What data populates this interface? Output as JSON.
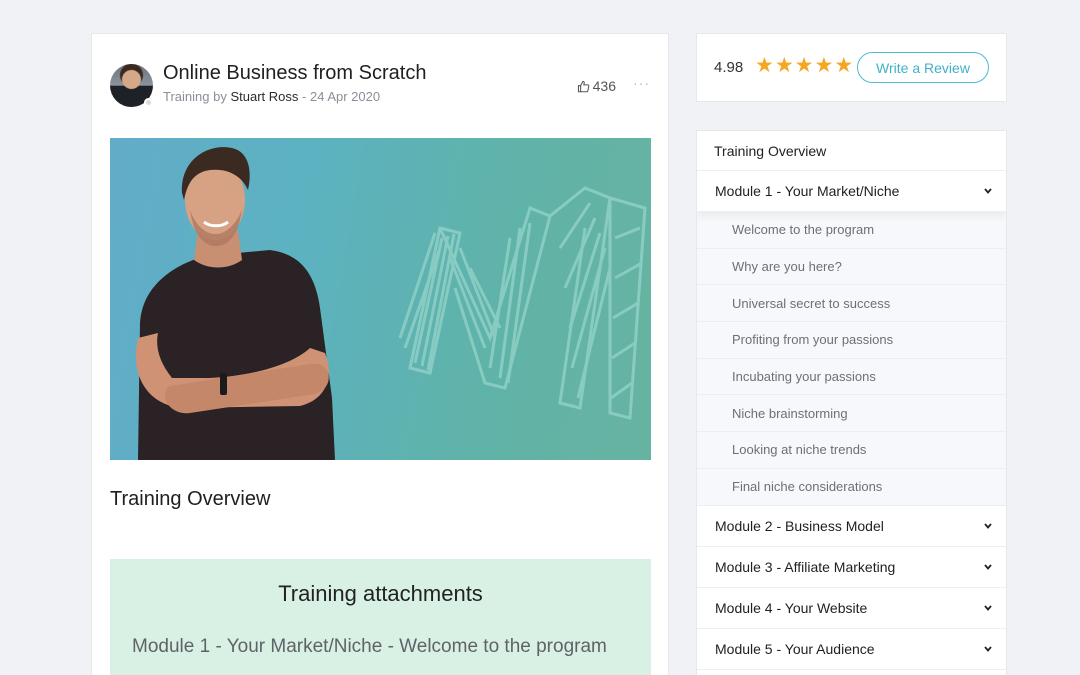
{
  "course": {
    "title": "Online Business from Scratch",
    "byline_prefix": "Training by",
    "author": "Stuart Ross",
    "date_sep": "-",
    "date": "24 Apr 2020",
    "likes": "436",
    "more": "···"
  },
  "main": {
    "overview_title": "Training Overview",
    "attachments_title": "Training attachments",
    "attachment_item": "Module 1 - Your Market/Niche - Welcome to the program"
  },
  "rating": {
    "score": "4.98",
    "stars": 5,
    "write_review": "Write a Review"
  },
  "sidebar": {
    "overview": "Training Overview",
    "modules": [
      {
        "label": "Module 1 - Your Market/Niche",
        "expanded": true
      },
      {
        "label": "Module 2 - Business Model"
      },
      {
        "label": "Module 3 - Affiliate Marketing"
      },
      {
        "label": "Module 4 - Your Website"
      },
      {
        "label": "Module 5 - Your Audience"
      }
    ],
    "lessons": [
      "Welcome to the program",
      "Why are you here?",
      "Universal secret to success",
      "Profiting from your passions",
      "Incubating your passions",
      "Niche brainstorming",
      "Looking at niche trends",
      "Final niche considerations"
    ]
  },
  "colors": {
    "accent": "#3fb2c6",
    "star": "#f5a623",
    "attachments_bg": "#d9f1e4",
    "hero_bg": "#5fb1b8"
  }
}
